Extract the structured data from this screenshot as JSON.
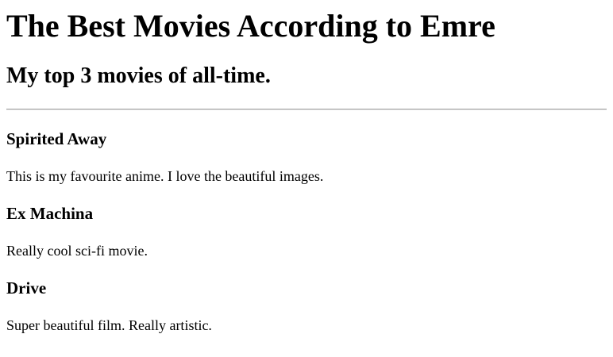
{
  "header": {
    "title": "The Best Movies According to Emre",
    "subtitle": "My top 3 movies of all-time."
  },
  "movies": [
    {
      "title": "Spirited Away",
      "description": "This is my favourite anime. I love the beautiful images."
    },
    {
      "title": "Ex Machina",
      "description": "Really cool sci-fi movie."
    },
    {
      "title": "Drive",
      "description": "Super beautiful film. Really artistic."
    }
  ]
}
